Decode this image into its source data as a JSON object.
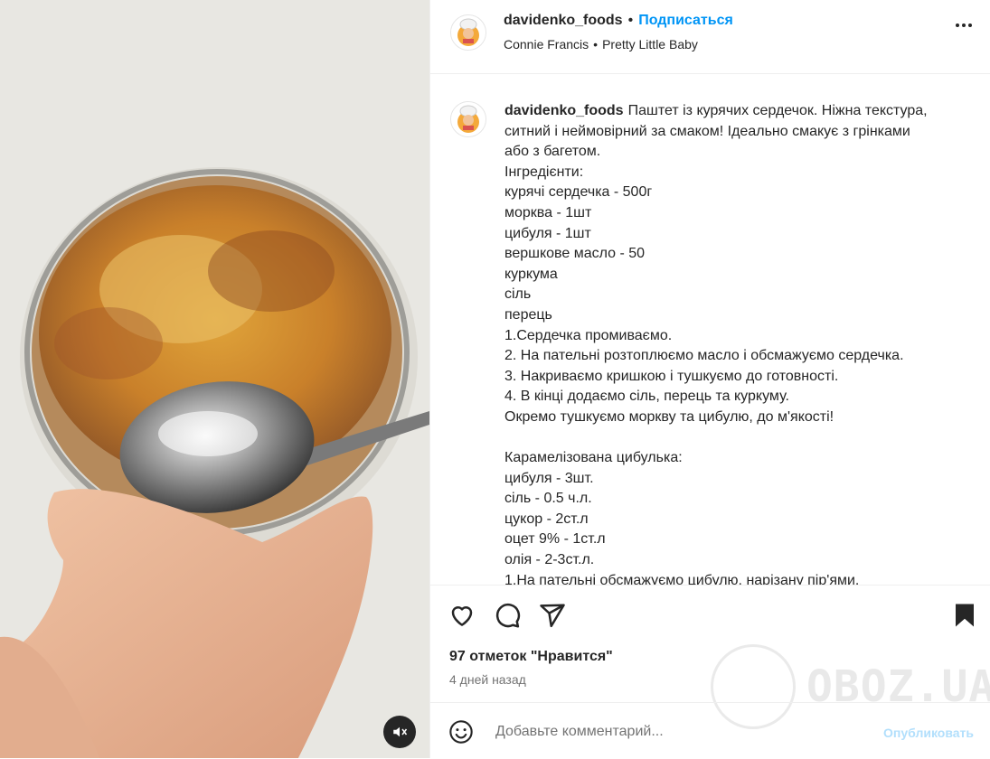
{
  "post": {
    "username": "davidenko_foods",
    "separator": "•",
    "follow_label": "Подписаться",
    "audio_artist": "Connie Francis",
    "audio_separator": "•",
    "audio_track": "Pretty Little Baby"
  },
  "caption": {
    "username": "davidenko_foods",
    "lines": [
      "Паштет із курячих сердечок. Ніжна текстура,",
      "ситний і неймовірний за смаком! Ідеально смакує з грінками",
      "або з багетом.",
      "Інгредієнти:",
      "курячі сердечка - 500г",
      "морква - 1шт",
      "цибуля - 1шт",
      "вершкове масло - 50",
      "куркума",
      "сіль",
      "перець",
      "1.Сердечка промиваємо.",
      "2. На пательні розтоплюємо масло і обсмажуємо сердечка.",
      "3. Накриваємо кришкою і тушкуємо до готовності.",
      "4. В кінці додаємо сіль, перець та куркуму.",
      "Окремо тушкуємо моркву та цибулю, до м'якості!",
      "",
      "Карамелізована цибулька:",
      "цибуля - 3шт.",
      "сіль - 0.5 ч.л.",
      "цукор - 2ст.л",
      "оцет 9% - 1ст.л",
      "олія - 2-3ст.л.",
      "1.На пательні обсмажуємо цибулю, нарізану пір'ями."
    ]
  },
  "engagement": {
    "likes_label": "97 отметок \"Нравится\"",
    "time_label": "4 дней назад"
  },
  "comment": {
    "placeholder": "Добавьте комментарий...",
    "publish_label": "Опубликовать"
  },
  "watermark": {
    "text": "OBOZ.UA"
  },
  "colors": {
    "accent": "#0095f6",
    "publish_disabled": "#b2dffc",
    "secondary_text": "#737373",
    "border": "#efefef"
  },
  "icons": [
    "heart-icon",
    "comment-icon",
    "share-icon",
    "bookmark-icon",
    "emoji-icon",
    "more-icon",
    "mute-icon"
  ]
}
